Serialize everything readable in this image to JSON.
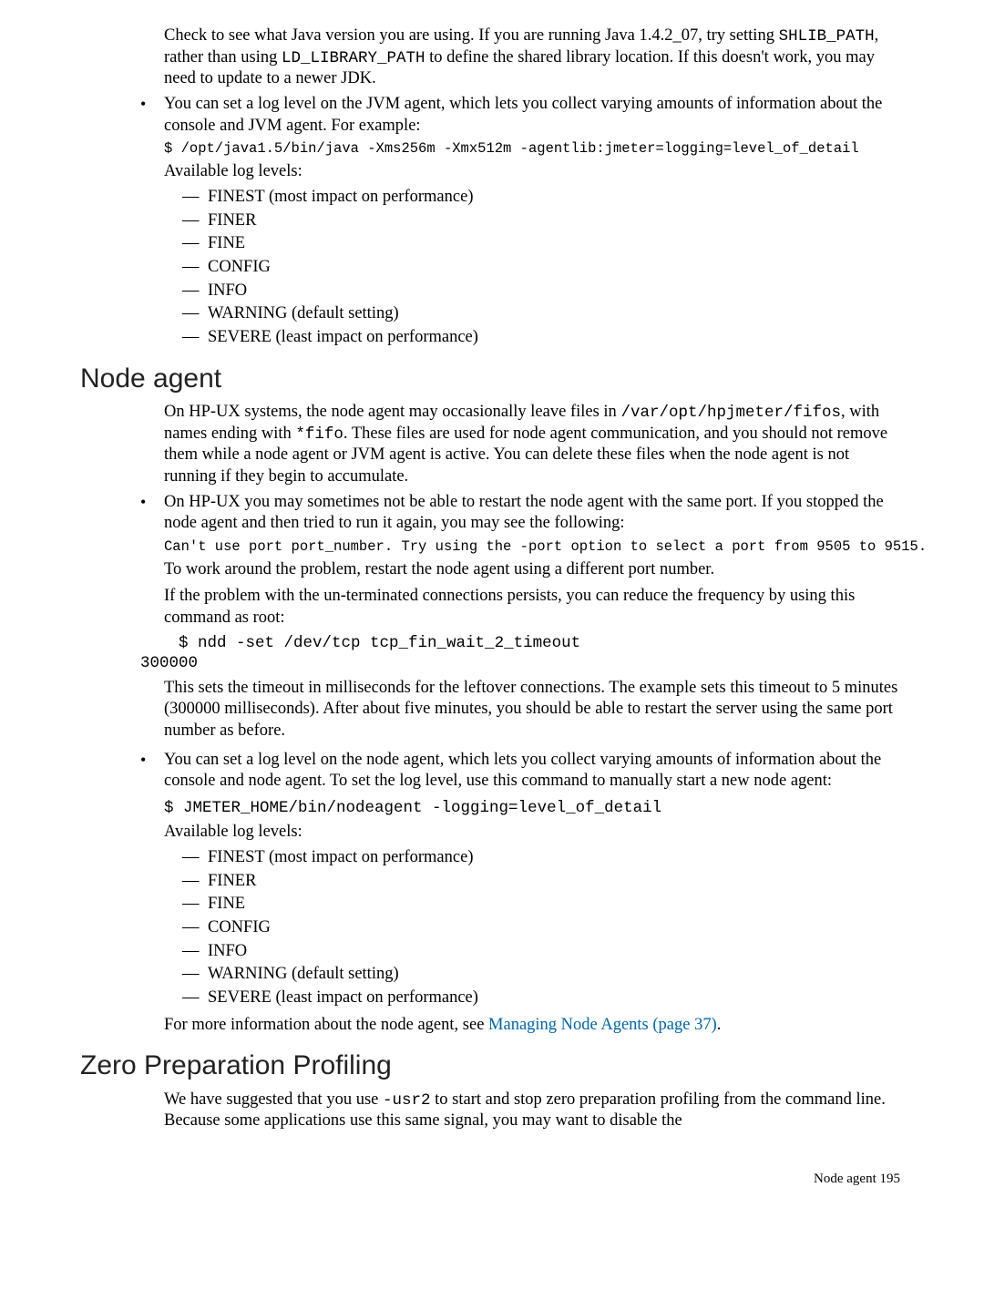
{
  "top": {
    "p1a": "Check to see what Java version you are using. If you are running Java 1.4.2_07, try setting ",
    "c1": "SHLIB_PATH",
    "p1b": ", rather than using ",
    "c2": "LD_LIBRARY_PATH",
    "p1c": " to define the shared library location. If this doesn't work, you may need to update to a newer JDK."
  },
  "jvm": {
    "bullet_p": "You can set a log level on the JVM agent, which lets you collect varying amounts of information about the console and JVM agent. For example:",
    "cmd": "$ /opt/java1.5/bin/java -Xms256m -Xmx512m -agentlib:jmeter=logging=level_of_detail",
    "avail": "Available log levels:",
    "levels": [
      "FINEST (most impact on performance)",
      "FINER",
      "FINE",
      "CONFIG",
      "INFO",
      "WARNING (default setting)",
      "SEVERE (least impact on performance)"
    ]
  },
  "node": {
    "heading": "Node agent",
    "intro_a": "On HP-UX systems, the node agent may occasionally leave files in ",
    "intro_c1": "/var/opt/hpjmeter/fifos",
    "intro_b": ", with names ending with ",
    "intro_c2": "*fifo",
    "intro_c": ". These files are used for node agent communication, and you should not remove them while a node agent or JVM agent is active. You can delete these files when the node agent is not running if they begin to accumulate.",
    "b1_p1": "On HP-UX you may sometimes not be able to restart the node agent with the same port. If you stopped the node agent and then tried to run it again, you may see the following:",
    "b1_cmd1": "Can't use port port_number. Try using the -port option to select a port from 9505 to 9515.",
    "b1_p2": "To work around the problem, restart the node agent using a different port number.",
    "b1_p3": "If the problem with the un-terminated connections persists, you can reduce the frequency by using this command as root:",
    "b1_cmd2": "    $ ndd -set /dev/tcp tcp_fin_wait_2_timeout\n300000",
    "b1_p4": "This sets the timeout in milliseconds for the leftover connections. The example sets this timeout to 5 minutes (300000 milliseconds). After about five minutes, you should be able to restart the server using the same port number as before.",
    "b2_p1": "You can set a log level on the node agent, which lets you collect varying amounts of information about the console and node agent. To set the log level, use this command to manually start a new node agent:",
    "b2_cmd": "$ JMETER_HOME/bin/nodeagent -logging=level_of_detail",
    "b2_avail": "Available log levels:",
    "b2_levels": [
      "FINEST (most impact on performance)",
      "FINER",
      "FINE",
      "CONFIG",
      "INFO",
      "WARNING (default setting)",
      "SEVERE (least impact on performance)"
    ],
    "more_a": "For more information about the node agent, see ",
    "more_link": "Managing Node Agents (page 37)",
    "more_b": "."
  },
  "zero": {
    "heading": "Zero Preparation Profiling",
    "p_a": "We have suggested that you use ",
    "p_c": "-usr2",
    "p_b": " to start and stop zero preparation profiling from the command line. Because some applications use this same signal, you may want to disable the"
  },
  "footer": {
    "text": "Node agent     195"
  }
}
